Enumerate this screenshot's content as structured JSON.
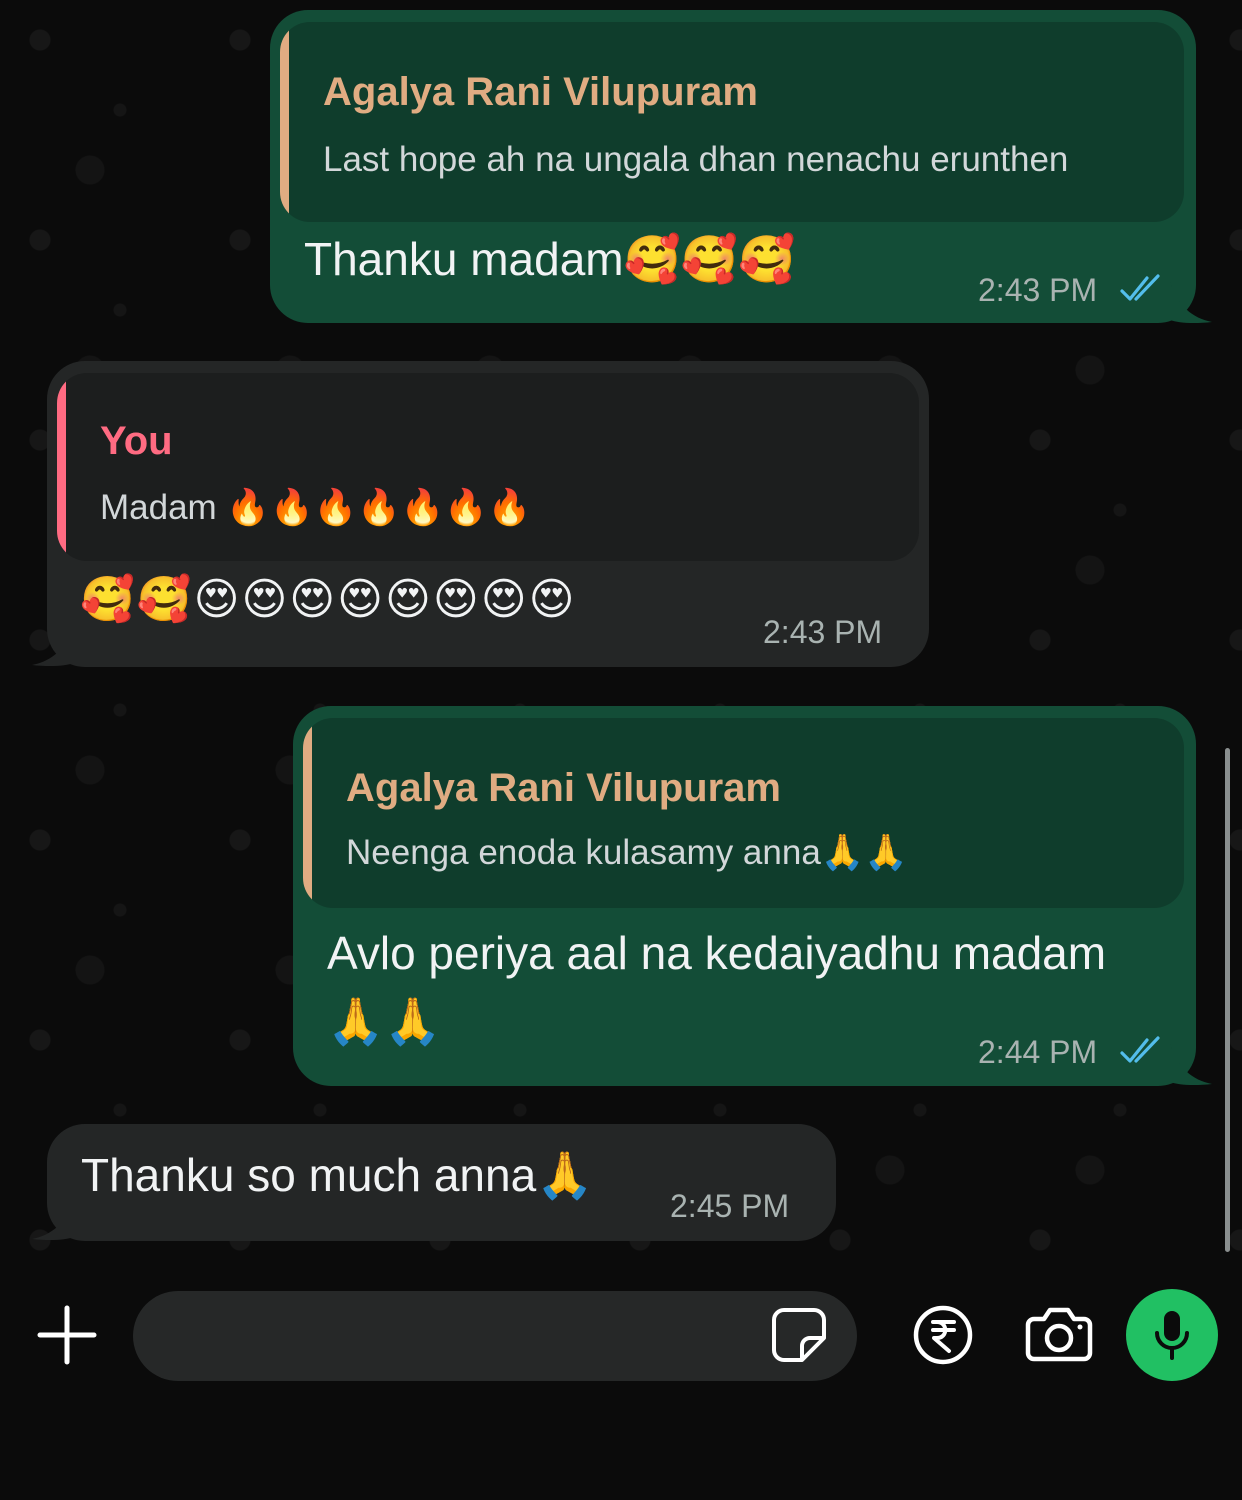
{
  "colors": {
    "outgoing_bubble": "#134d37",
    "incoming_bubble": "#242626",
    "quote_name_other": "#e0ac82",
    "quote_name_you": "#ff6b82",
    "read_ticks": "#53bdeb",
    "mic_button": "#21c063"
  },
  "messages": [
    {
      "direction": "outgoing",
      "quote": {
        "name": "Agalya Rani Vilupuram",
        "text": "Last hope ah na ungala dhan nenachu erunthen"
      },
      "text": "Thanku madam🥰🥰🥰",
      "time": "2:43 PM",
      "status": "read"
    },
    {
      "direction": "incoming",
      "quote": {
        "name": "You",
        "text": "Madam 🔥🔥🔥🔥🔥🔥🔥"
      },
      "text": "🥰🥰😍😍😍😍😍😍😍😍",
      "time": "2:43 PM"
    },
    {
      "direction": "outgoing",
      "quote": {
        "name": "Agalya Rani Vilupuram",
        "text": "Neenga enoda kulasamy anna🙏🙏"
      },
      "text_line1": "Avlo periya aal na kedaiyadhu madam",
      "text_line2": "🙏🙏",
      "time": "2:44 PM",
      "status": "read"
    },
    {
      "direction": "incoming",
      "text": "Thanku so much anna🙏",
      "time": "2:45 PM"
    }
  ],
  "composer": {
    "placeholder": "",
    "icons": [
      "plus-icon",
      "sticker-icon",
      "rupee-payment-icon",
      "camera-icon",
      "microphone-icon"
    ]
  }
}
